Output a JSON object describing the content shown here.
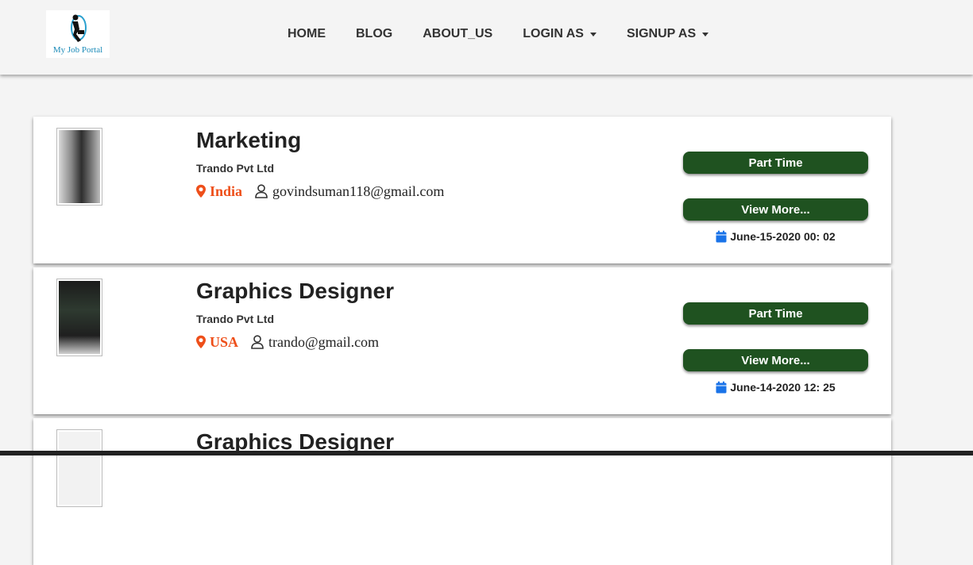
{
  "brand": {
    "logo_text": "My Job Portal"
  },
  "nav": {
    "items": [
      {
        "label": "HOME"
      },
      {
        "label": "BLOG"
      },
      {
        "label": "ABOUT_US"
      },
      {
        "label": "LOGIN AS"
      },
      {
        "label": "SIGNUP AS"
      }
    ]
  },
  "jobs": [
    {
      "title": "Marketing",
      "company": "Trando Pvt Ltd",
      "country": "India",
      "email": "govindsuman118@gmail.com",
      "job_type": "Part Time",
      "view_more": "View More...",
      "date": "June-15-2020 00: 02"
    },
    {
      "title": "Graphics Designer",
      "company": "Trando Pvt Ltd",
      "country": "USA",
      "email": "trando@gmail.com",
      "job_type": "Part Time",
      "view_more": "View More...",
      "date": "June-14-2020 12: 25"
    },
    {
      "title": "Graphics Designer"
    }
  ],
  "colors": {
    "button": "#1f5220",
    "country": "#ee4f1a",
    "calendar_icon": "#1a73e8"
  },
  "icons": [
    "map-marker-icon",
    "user-icon",
    "calendar-icon",
    "caret-down-icon"
  ]
}
